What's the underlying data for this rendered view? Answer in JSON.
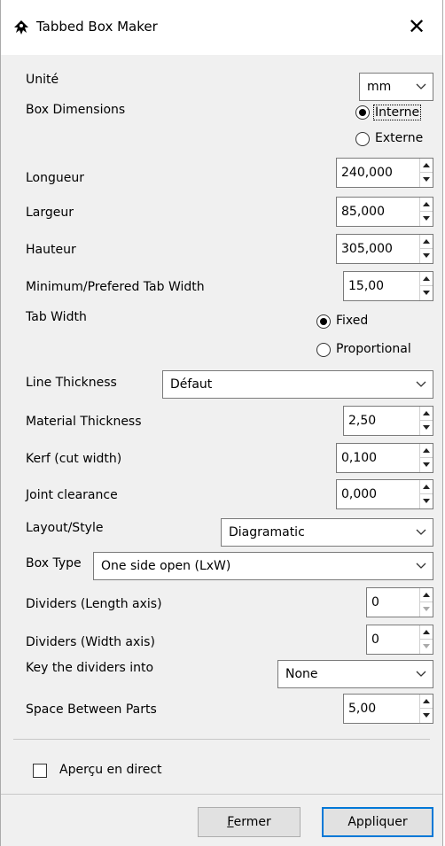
{
  "window": {
    "title": "Tabbed Box Maker",
    "close_glyph": "✕"
  },
  "form": {
    "unit": {
      "label": "Unité",
      "value": "mm"
    },
    "box_dimensions": {
      "label": "Box Dimensions",
      "options": [
        "Interne",
        "Externe"
      ],
      "selected": "Interne"
    },
    "longueur": {
      "label": "Longueur",
      "value": "240,000"
    },
    "largeur": {
      "label": "Largeur",
      "value": "85,000"
    },
    "hauteur": {
      "label": "Hauteur",
      "value": "305,000"
    },
    "min_tab_width": {
      "label": "Minimum/Prefered Tab Width",
      "value": "15,00"
    },
    "tab_width": {
      "label": "Tab Width",
      "options": [
        "Fixed",
        "Proportional"
      ],
      "selected": "Fixed"
    },
    "line_thickness": {
      "label": "Line Thickness",
      "value": "Défaut"
    },
    "material_thickness": {
      "label": "Material Thickness",
      "value": "2,50"
    },
    "kerf": {
      "label": "Kerf (cut width)",
      "value": "0,100"
    },
    "joint_clearance": {
      "label": "Joint clearance",
      "value": "0,000"
    },
    "layout_style": {
      "label": "Layout/Style",
      "value": "Diagramatic"
    },
    "box_type": {
      "label": "Box Type",
      "value": "One side open (LxW)"
    },
    "dividers_length": {
      "label": "Dividers (Length axis)",
      "value": "0"
    },
    "dividers_width": {
      "label": "Dividers (Width axis)",
      "value": "0"
    },
    "key_dividers": {
      "label": "Key the dividers into",
      "value": "None"
    },
    "space_between": {
      "label": "Space Between Parts",
      "value": "5,00"
    }
  },
  "live_preview": {
    "label": "Aperçu en direct",
    "checked": false
  },
  "buttons": {
    "close": {
      "mnemonic": "F",
      "rest": "ermer"
    },
    "apply": {
      "label": "Appliquer"
    }
  },
  "icons": {
    "app": "inkscape-icon",
    "close": "close-icon",
    "dropdown": "chevron-down-icon",
    "spin_up": "spin-up-icon",
    "spin_down": "spin-down-icon"
  },
  "colors": {
    "window_bg": "#f0f0f0",
    "titlebar_bg": "#ffffff",
    "primary_border": "#0078d7"
  }
}
